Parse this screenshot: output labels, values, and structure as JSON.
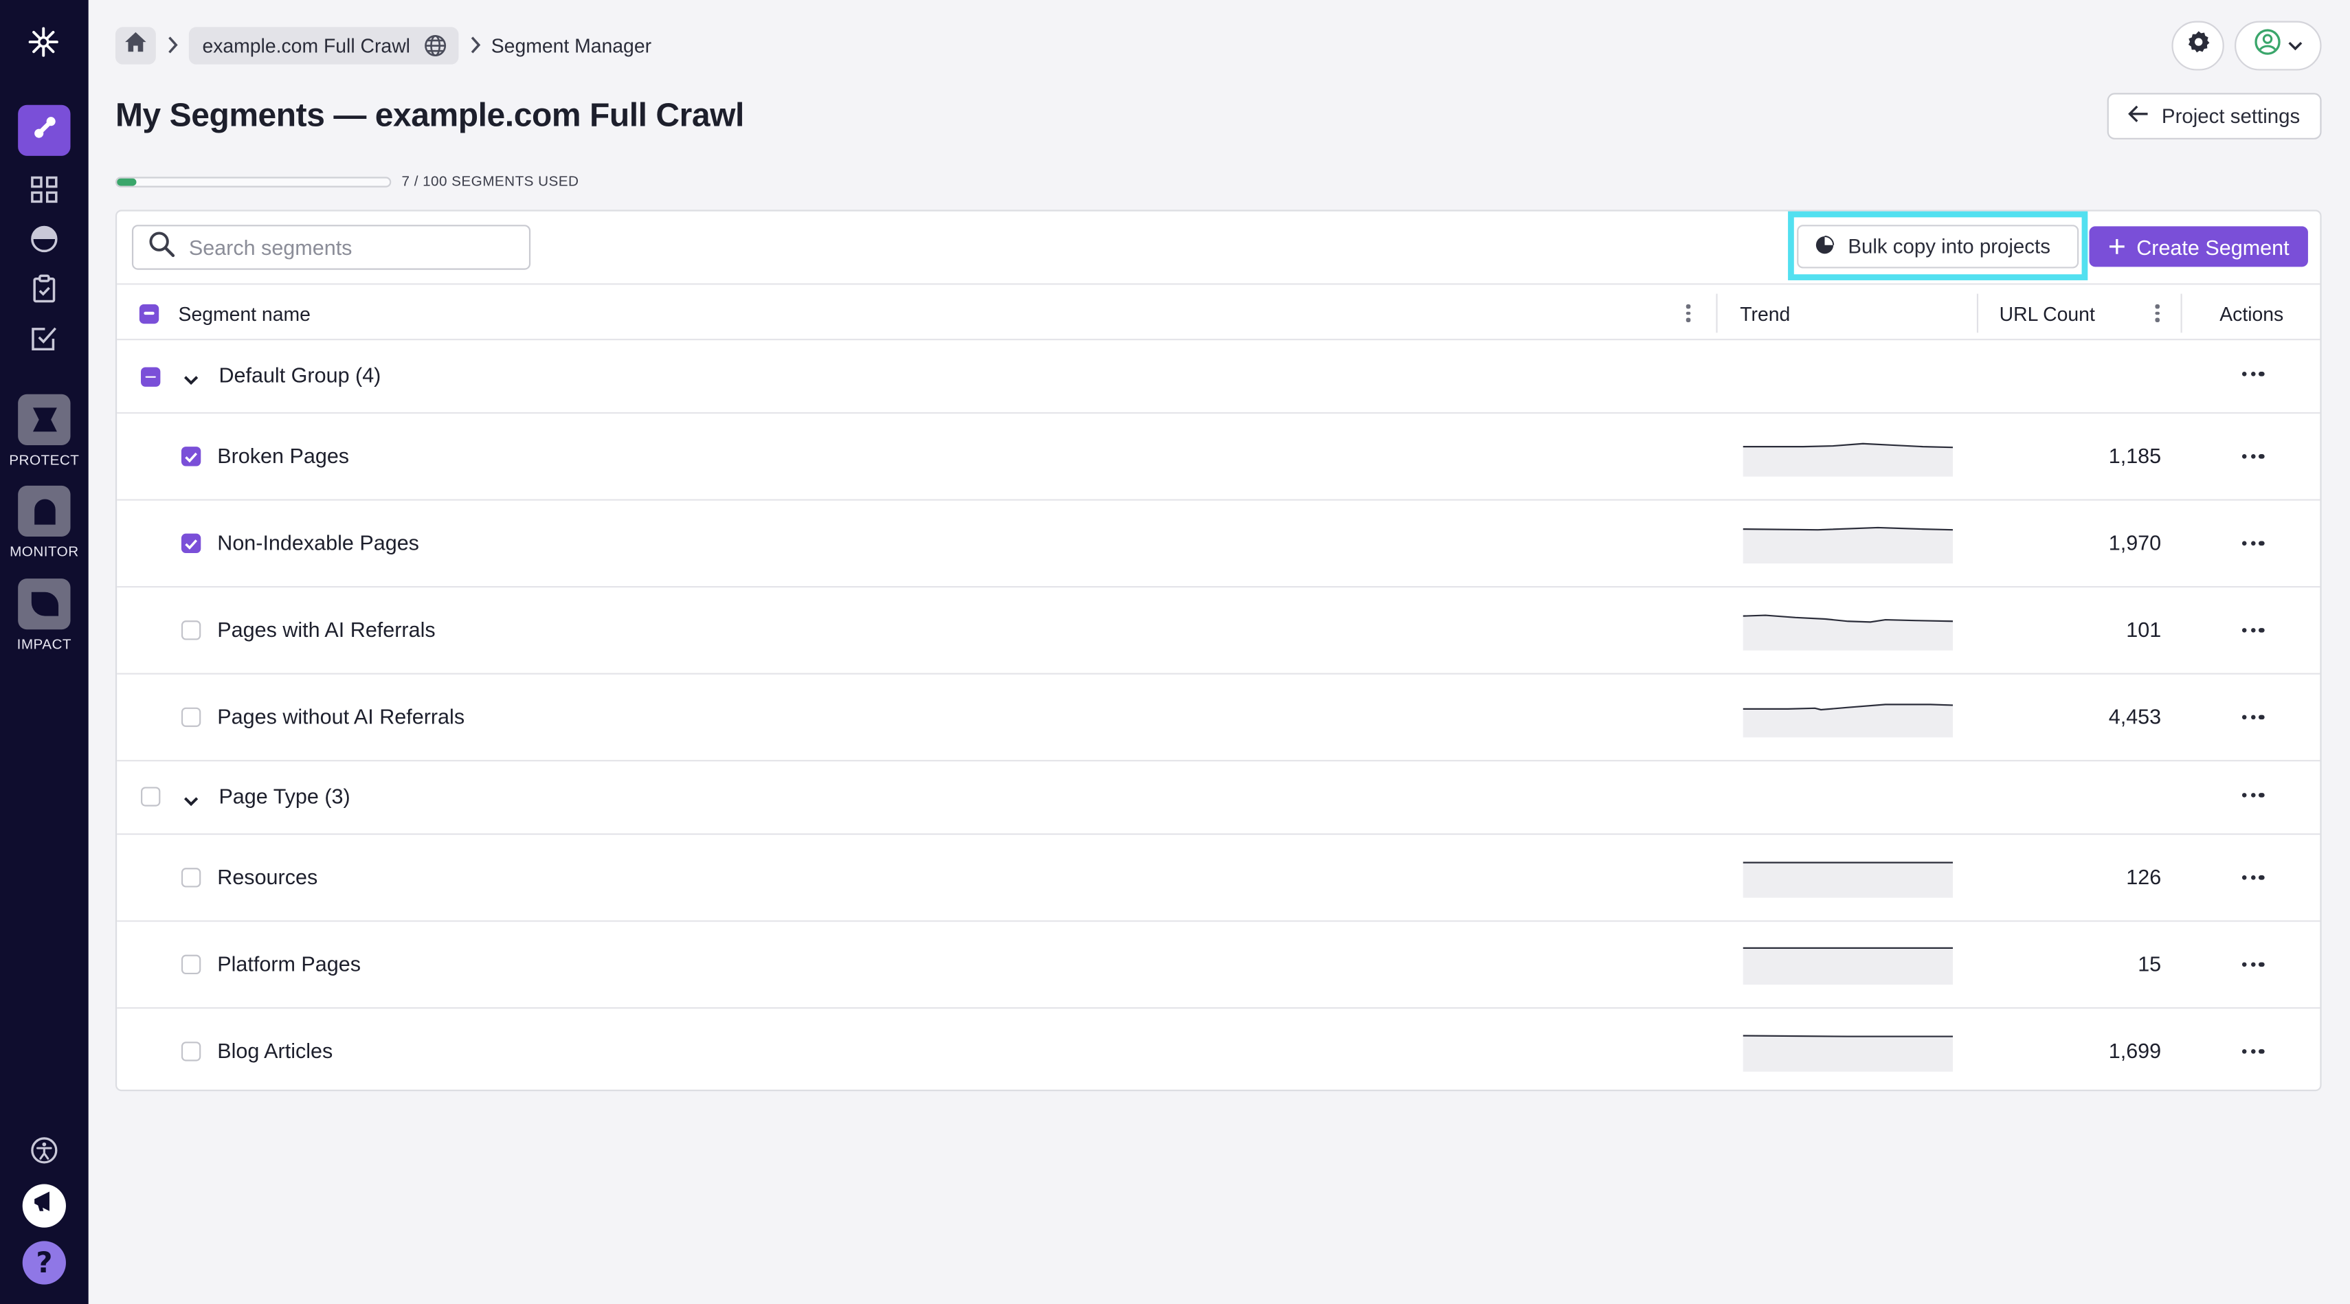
{
  "breadcrumb": {
    "project": "example.com Full Crawl",
    "current": "Segment Manager"
  },
  "page": {
    "title": "My Segments — example.com Full Crawl",
    "project_settings_label": "Project settings"
  },
  "usage": {
    "used": 7,
    "limit": 100,
    "label": "7 / 100 SEGMENTS USED"
  },
  "sidebar": {
    "products": [
      {
        "label": "PROTECT"
      },
      {
        "label": "MONITOR"
      },
      {
        "label": "IMPACT"
      }
    ]
  },
  "toolbar": {
    "search_placeholder": "Search segments",
    "bulk_copy_label": "Bulk copy into projects",
    "create_label": "Create Segment"
  },
  "table": {
    "columns": {
      "name": "Segment name",
      "trend": "Trend",
      "url_count": "URL Count",
      "actions": "Actions"
    },
    "groups": [
      {
        "label": "Default Group (4)",
        "state": "indeterminate",
        "rows": [
          {
            "name": "Broken Pages",
            "count": "1,185",
            "checked": true
          },
          {
            "name": "Non-Indexable Pages",
            "count": "1,970",
            "checked": true
          },
          {
            "name": "Pages with AI Referrals",
            "count": "101",
            "checked": false
          },
          {
            "name": "Pages without AI Referrals",
            "count": "4,453",
            "checked": false
          }
        ]
      },
      {
        "label": "Page Type (3)",
        "state": "unchecked",
        "rows": [
          {
            "name": "Resources",
            "count": "126",
            "checked": false
          },
          {
            "name": "Platform Pages",
            "count": "15",
            "checked": false
          },
          {
            "name": "Blog Articles",
            "count": "1,699",
            "checked": false
          }
        ]
      }
    ]
  },
  "colors": {
    "accent": "#7a4fd8",
    "sidebar_bg": "#0f0d2e",
    "usage_fill": "#3aa66b",
    "highlight": "#52e0f0"
  }
}
